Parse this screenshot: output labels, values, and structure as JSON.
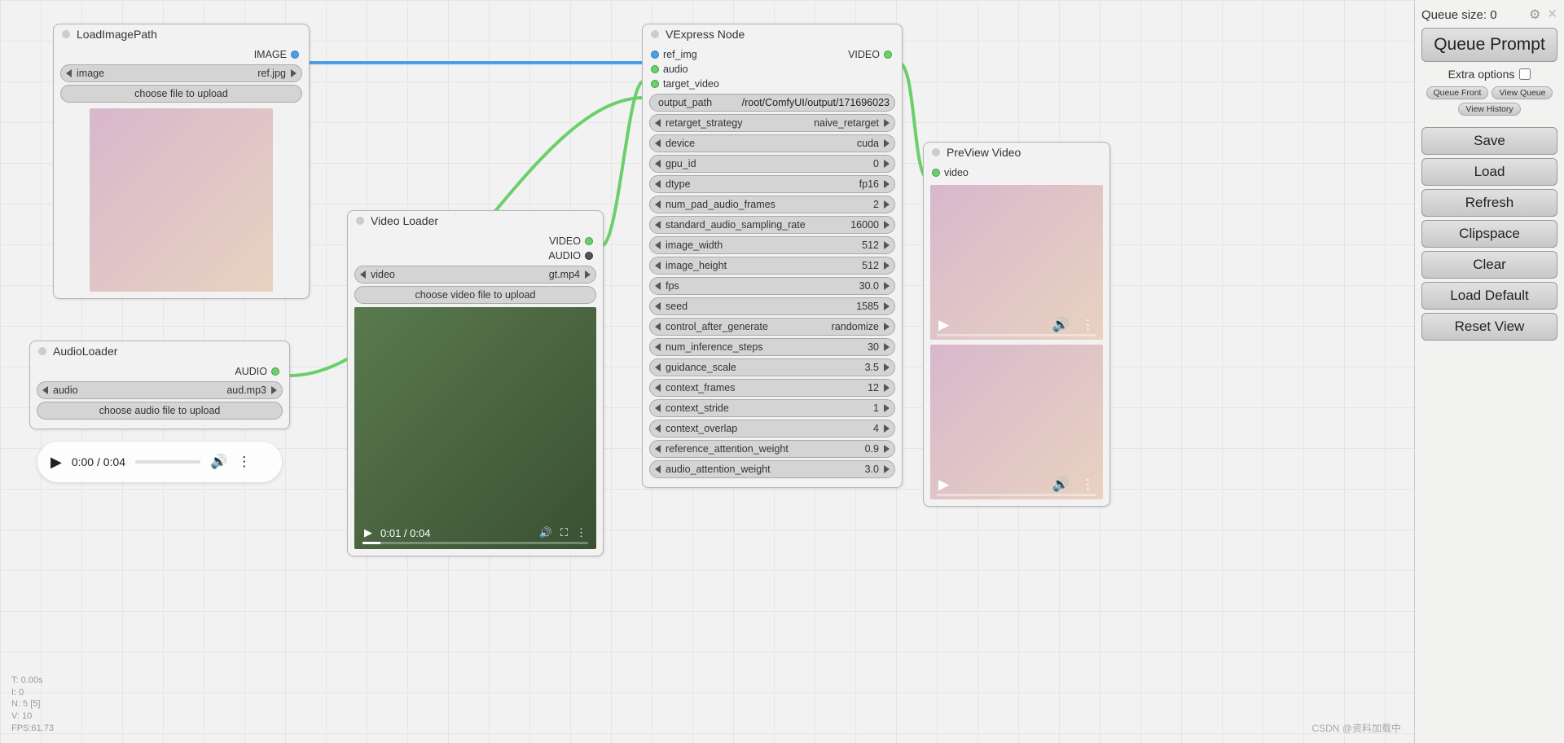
{
  "sidepanel": {
    "queue_label": "Queue size: 0",
    "queue_prompt": "Queue Prompt",
    "extra_options": "Extra options",
    "queue_front": "Queue Front",
    "view_queue": "View Queue",
    "view_history": "View History",
    "save": "Save",
    "load": "Load",
    "refresh": "Refresh",
    "clipspace": "Clipspace",
    "clear": "Clear",
    "load_default": "Load Default",
    "reset_view": "Reset View"
  },
  "stats": {
    "t": "T: 0.00s",
    "i": "I: 0",
    "n": "N: 5 [5]",
    "v": "V: 10",
    "fps": "FPS:61.73"
  },
  "watermark": "CSDN @资料加载中",
  "nodes": {
    "load_image": {
      "title": "LoadImagePath",
      "out_image": "IMAGE",
      "image_label": "image",
      "image_value": "ref.jpg",
      "choose": "choose file to upload"
    },
    "audio_loader": {
      "title": "AudioLoader",
      "out_audio": "AUDIO",
      "audio_label": "audio",
      "audio_value": "aud.mp3",
      "choose": "choose audio file to upload"
    },
    "audio_player": {
      "time": "0:00 / 0:04"
    },
    "video_loader": {
      "title": "Video Loader",
      "out_video": "VIDEO",
      "out_audio": "AUDIO",
      "video_label": "video",
      "video_value": "gt.mp4",
      "choose": "choose video file to upload",
      "play_time": "0:01 / 0:04"
    },
    "vexpress": {
      "title": "VExpress Node",
      "in_ref": "ref_img",
      "in_audio": "audio",
      "in_tv": "target_video",
      "out_video": "VIDEO",
      "rows": [
        {
          "k": "output_path",
          "v": "/root/ComfyUI/output/171696023",
          "text": true
        },
        {
          "k": "retarget_strategy",
          "v": "naive_retarget"
        },
        {
          "k": "device",
          "v": "cuda"
        },
        {
          "k": "gpu_id",
          "v": "0"
        },
        {
          "k": "dtype",
          "v": "fp16"
        },
        {
          "k": "num_pad_audio_frames",
          "v": "2"
        },
        {
          "k": "standard_audio_sampling_rate",
          "v": "16000"
        },
        {
          "k": "image_width",
          "v": "512"
        },
        {
          "k": "image_height",
          "v": "512"
        },
        {
          "k": "fps",
          "v": "30.0"
        },
        {
          "k": "seed",
          "v": "1585"
        },
        {
          "k": "control_after_generate",
          "v": "randomize"
        },
        {
          "k": "num_inference_steps",
          "v": "30"
        },
        {
          "k": "guidance_scale",
          "v": "3.5"
        },
        {
          "k": "context_frames",
          "v": "12"
        },
        {
          "k": "context_stride",
          "v": "1"
        },
        {
          "k": "context_overlap",
          "v": "4"
        },
        {
          "k": "reference_attention_weight",
          "v": "0.9"
        },
        {
          "k": "audio_attention_weight",
          "v": "3.0"
        }
      ]
    },
    "preview": {
      "title": "PreView Video",
      "in_video": "video"
    }
  }
}
